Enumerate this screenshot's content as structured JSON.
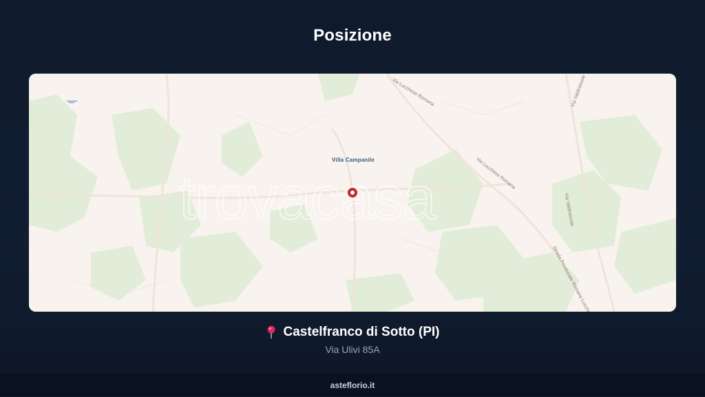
{
  "header": {
    "title": "Posizione"
  },
  "map": {
    "place_label": "Villa Campanile",
    "watermark": "trovacasa",
    "road_labels": [
      "Via Lucchese Romana",
      "Via Lucchese Romana",
      "Via Valdinievole",
      "Via Valdinievole",
      "Strada Provinciale Romana Lucchese"
    ],
    "colors": {
      "land": "#f8f3ef",
      "green": "#e3eedb",
      "marker": "#c0282d"
    }
  },
  "location": {
    "city": "Castelfranco di Sotto (PI)",
    "address": "Via Ulivi 85A",
    "icon": "map-pin-icon"
  },
  "footer": {
    "site": "asteflorio.it"
  }
}
